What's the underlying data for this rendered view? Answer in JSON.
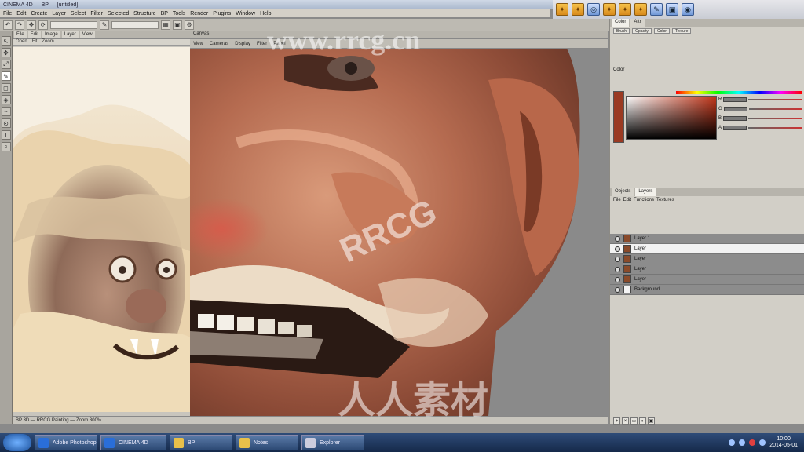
{
  "window": {
    "title": "CINEMA 4D — BP — [untitled]"
  },
  "menu": {
    "items": [
      "File",
      "Edit",
      "Create",
      "Layer",
      "Select",
      "Filter",
      "Selected",
      "Structure",
      "BP",
      "Tools",
      "Render",
      "Plugins",
      "Window",
      "Help"
    ]
  },
  "toolbar": {
    "field_label": "Size"
  },
  "ref_panel": {
    "tabs": [
      "File",
      "Edit",
      "Image",
      "Layer",
      "View"
    ],
    "subtools": [
      "Open",
      "Fit",
      "Zoom"
    ]
  },
  "canvas": {
    "title": "Canvas",
    "subtabs": [
      "View",
      "Cameras",
      "Display",
      "Filter",
      "Panel"
    ]
  },
  "status": {
    "text": "BP 3D — RRCG Painting — Zoom 300%"
  },
  "right_panel": {
    "top_tabs": [
      "Color",
      "Attr"
    ],
    "chips": [
      "Brush",
      "Opacity",
      "Color",
      "Texture"
    ],
    "color_label": "Color",
    "sliders": [
      "R",
      "G",
      "B",
      "A"
    ],
    "layers_tabs": [
      "Objects",
      "Layers"
    ],
    "layers_menu": [
      "File",
      "Edit",
      "Functions",
      "Textures"
    ],
    "layers": [
      {
        "name": "Layer 1",
        "selected": false
      },
      {
        "name": "Layer",
        "selected": true
      },
      {
        "name": "Layer",
        "selected": false
      },
      {
        "name": "Layer",
        "selected": false
      },
      {
        "name": "Layer",
        "selected": false
      },
      {
        "name": "Background",
        "selected": false
      }
    ]
  },
  "taskbar": {
    "tasks": [
      "Adobe Photoshop",
      "CINEMA 4D",
      "BP",
      "Notes",
      "Explorer"
    ],
    "clock_time": "10:00",
    "clock_date": "2014-05-01"
  },
  "watermarks": [
    "www.rrcg.cn",
    "RRCG",
    "人人素材"
  ]
}
